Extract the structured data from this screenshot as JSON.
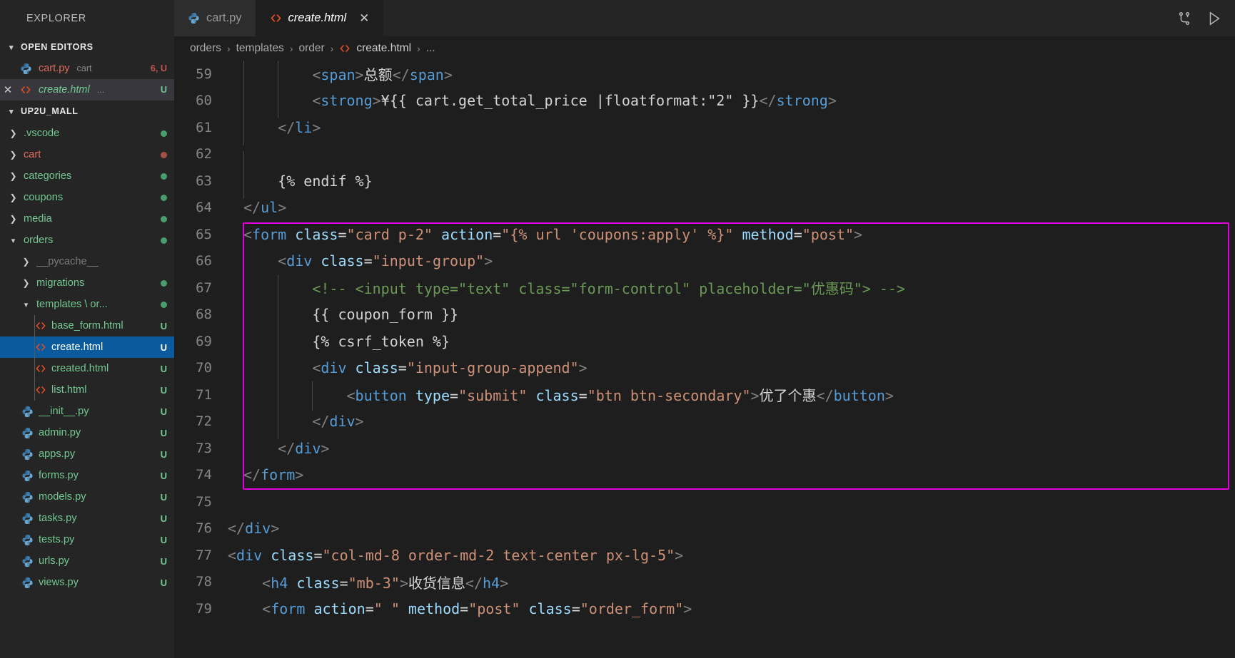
{
  "window": {
    "topbar_icons": [
      {
        "name": "source-control-icon",
        "glyph": "source-control"
      },
      {
        "name": "run-play-icon",
        "glyph": "play-outline"
      }
    ]
  },
  "sidebar": {
    "title": "EXPLORER",
    "open_editors": {
      "label": "OPEN EDITORS",
      "items": [
        {
          "name": "cart.py",
          "icon": "python-icon",
          "sub": "cart",
          "badge": "6, U",
          "badge_color": "#c0544d",
          "name_color": "#e06c5e",
          "selected": false,
          "closable": false,
          "italic": false
        },
        {
          "name": "create.html",
          "icon": "html-icon",
          "sub": "...",
          "badge": "U",
          "badge_color": "#73c991",
          "name_color": "#73c991",
          "selected": true,
          "closable": true,
          "italic": true
        }
      ]
    },
    "workspace": {
      "label": "UP2U_MALL",
      "items": [
        {
          "label": ".vscode",
          "type": "folder",
          "depth": 1,
          "expanded": false,
          "color": "#73c991",
          "dot": "#4a9e6d",
          "badge": ""
        },
        {
          "label": "cart",
          "type": "folder",
          "depth": 1,
          "expanded": false,
          "color": "#e06c5e",
          "dot": "#a35049",
          "badge": ""
        },
        {
          "label": "categories",
          "type": "folder",
          "depth": 1,
          "expanded": false,
          "color": "#73c991",
          "dot": "#4a9e6d",
          "badge": ""
        },
        {
          "label": "coupons",
          "type": "folder",
          "depth": 1,
          "expanded": false,
          "color": "#73c991",
          "dot": "#4a9e6d",
          "badge": ""
        },
        {
          "label": "media",
          "type": "folder",
          "depth": 1,
          "expanded": false,
          "color": "#73c991",
          "dot": "#4a9e6d",
          "badge": ""
        },
        {
          "label": "orders",
          "type": "folder",
          "depth": 1,
          "expanded": true,
          "color": "#73c991",
          "dot": "#4a9e6d",
          "badge": ""
        },
        {
          "label": "__pycache__",
          "type": "folder",
          "depth": 2,
          "expanded": false,
          "color": "#7a7a7a",
          "dot": "",
          "badge": ""
        },
        {
          "label": "migrations",
          "type": "folder",
          "depth": 2,
          "expanded": false,
          "color": "#73c991",
          "dot": "#4a9e6d",
          "badge": ""
        },
        {
          "label": "templates \\ or...",
          "type": "folder",
          "depth": 2,
          "expanded": true,
          "color": "#73c991",
          "dot": "#4a9e6d",
          "badge": ""
        },
        {
          "label": "base_form.html",
          "type": "html",
          "depth": 3,
          "expanded": false,
          "color": "#73c991",
          "dot": "",
          "badge": "U",
          "badge_color": "#73c991"
        },
        {
          "label": "create.html",
          "type": "html",
          "depth": 3,
          "expanded": false,
          "color": "#ffffff",
          "dot": "",
          "badge": "U",
          "badge_color": "#ffffff",
          "selected": true
        },
        {
          "label": "created.html",
          "type": "html",
          "depth": 3,
          "expanded": false,
          "color": "#73c991",
          "dot": "",
          "badge": "U",
          "badge_color": "#73c991"
        },
        {
          "label": "list.html",
          "type": "html",
          "depth": 3,
          "expanded": false,
          "color": "#73c991",
          "dot": "",
          "badge": "U",
          "badge_color": "#73c991"
        },
        {
          "label": "__init__.py",
          "type": "python",
          "depth": 2,
          "expanded": false,
          "color": "#73c991",
          "dot": "",
          "badge": "U",
          "badge_color": "#73c991"
        },
        {
          "label": "admin.py",
          "type": "python",
          "depth": 2,
          "expanded": false,
          "color": "#73c991",
          "dot": "",
          "badge": "U",
          "badge_color": "#73c991"
        },
        {
          "label": "apps.py",
          "type": "python",
          "depth": 2,
          "expanded": false,
          "color": "#73c991",
          "dot": "",
          "badge": "U",
          "badge_color": "#73c991"
        },
        {
          "label": "forms.py",
          "type": "python",
          "depth": 2,
          "expanded": false,
          "color": "#73c991",
          "dot": "",
          "badge": "U",
          "badge_color": "#73c991"
        },
        {
          "label": "models.py",
          "type": "python",
          "depth": 2,
          "expanded": false,
          "color": "#73c991",
          "dot": "",
          "badge": "U",
          "badge_color": "#73c991"
        },
        {
          "label": "tasks.py",
          "type": "python",
          "depth": 2,
          "expanded": false,
          "color": "#73c991",
          "dot": "",
          "badge": "U",
          "badge_color": "#73c991"
        },
        {
          "label": "tests.py",
          "type": "python",
          "depth": 2,
          "expanded": false,
          "color": "#73c991",
          "dot": "",
          "badge": "U",
          "badge_color": "#73c991"
        },
        {
          "label": "urls.py",
          "type": "python",
          "depth": 2,
          "expanded": false,
          "color": "#73c991",
          "dot": "",
          "badge": "U",
          "badge_color": "#73c991"
        },
        {
          "label": "views.py",
          "type": "python",
          "depth": 2,
          "expanded": false,
          "color": "#73c991",
          "dot": "",
          "badge": "U",
          "badge_color": "#73c991"
        }
      ]
    }
  },
  "tabs": [
    {
      "label": "cart.py",
      "icon": "python-icon",
      "active": false,
      "closable": false,
      "italic": false
    },
    {
      "label": "create.html",
      "icon": "html-icon",
      "active": true,
      "closable": true,
      "italic": true
    }
  ],
  "breadcrumb": {
    "parts": [
      "orders",
      "templates",
      "order"
    ],
    "file": "create.html",
    "ellipsis": "...",
    "separator": "›"
  },
  "editor": {
    "highlight_color": "#e000e0",
    "highlight_start_line": 65,
    "highlight_end_line": 74,
    "lines": [
      {
        "n": 59,
        "indent_guides": [
          0,
          1
        ],
        "tokens": [
          {
            "t": "txt",
            "v": "        "
          },
          {
            "t": "brk",
            "v": "<"
          },
          {
            "t": "tag",
            "v": "span"
          },
          {
            "t": "brk",
            "v": ">"
          },
          {
            "t": "txt",
            "v": "总额"
          },
          {
            "t": "brk",
            "v": "</"
          },
          {
            "t": "tag",
            "v": "span"
          },
          {
            "t": "brk",
            "v": ">"
          }
        ]
      },
      {
        "n": 60,
        "indent_guides": [
          0,
          1
        ],
        "tokens": [
          {
            "t": "txt",
            "v": "        "
          },
          {
            "t": "brk",
            "v": "<"
          },
          {
            "t": "tag",
            "v": "strong"
          },
          {
            "t": "brk",
            "v": ">"
          },
          {
            "t": "txt",
            "v": "¥{{ cart.get_total_price |floatformat:\"2\" }}"
          },
          {
            "t": "brk",
            "v": "</"
          },
          {
            "t": "tag",
            "v": "strong"
          },
          {
            "t": "brk",
            "v": ">"
          }
        ]
      },
      {
        "n": 61,
        "indent_guides": [
          0
        ],
        "tokens": [
          {
            "t": "txt",
            "v": "    "
          },
          {
            "t": "brk",
            "v": "</"
          },
          {
            "t": "tag",
            "v": "li"
          },
          {
            "t": "brk",
            "v": ">"
          }
        ]
      },
      {
        "n": 62,
        "indent_guides": [
          0
        ],
        "tokens": []
      },
      {
        "n": 63,
        "indent_guides": [
          0
        ],
        "tokens": [
          {
            "t": "txt",
            "v": "    "
          },
          {
            "t": "txt",
            "v": "{% endif %}"
          }
        ]
      },
      {
        "n": 64,
        "indent_guides": [],
        "tokens": [
          {
            "t": "brk",
            "v": "</"
          },
          {
            "t": "tag",
            "v": "ul"
          },
          {
            "t": "brk",
            "v": ">"
          }
        ]
      },
      {
        "n": 65,
        "indent_guides": [],
        "tokens": [
          {
            "t": "brk",
            "v": "<"
          },
          {
            "t": "tag",
            "v": "form"
          },
          {
            "t": "txt",
            "v": " "
          },
          {
            "t": "attr",
            "v": "class"
          },
          {
            "t": "eq",
            "v": "="
          },
          {
            "t": "str",
            "v": "\"card p-2\""
          },
          {
            "t": "txt",
            "v": " "
          },
          {
            "t": "attr",
            "v": "action"
          },
          {
            "t": "eq",
            "v": "="
          },
          {
            "t": "str",
            "v": "\"{% url 'coupons:apply' %}\""
          },
          {
            "t": "txt",
            "v": " "
          },
          {
            "t": "attr",
            "v": "method"
          },
          {
            "t": "eq",
            "v": "="
          },
          {
            "t": "str",
            "v": "\"post\""
          },
          {
            "t": "brk",
            "v": ">"
          }
        ]
      },
      {
        "n": 66,
        "indent_guides": [
          0
        ],
        "tokens": [
          {
            "t": "txt",
            "v": "    "
          },
          {
            "t": "brk",
            "v": "<"
          },
          {
            "t": "tag",
            "v": "div"
          },
          {
            "t": "txt",
            "v": " "
          },
          {
            "t": "attr",
            "v": "class"
          },
          {
            "t": "eq",
            "v": "="
          },
          {
            "t": "str",
            "v": "\"input-group\""
          },
          {
            "t": "brk",
            "v": ">"
          }
        ]
      },
      {
        "n": 67,
        "indent_guides": [
          0,
          1
        ],
        "tokens": [
          {
            "t": "txt",
            "v": "        "
          },
          {
            "t": "cmt",
            "v": "<!-- <input type=\"text\" class=\"form-control\" placeholder=\"优惠码\"> -->"
          }
        ]
      },
      {
        "n": 68,
        "indent_guides": [
          0,
          1
        ],
        "tokens": [
          {
            "t": "txt",
            "v": "        "
          },
          {
            "t": "txt",
            "v": "{{ coupon_form }}"
          }
        ]
      },
      {
        "n": 69,
        "indent_guides": [
          0,
          1
        ],
        "tokens": [
          {
            "t": "txt",
            "v": "        "
          },
          {
            "t": "txt",
            "v": "{% csrf_token %}"
          }
        ]
      },
      {
        "n": 70,
        "indent_guides": [
          0,
          1
        ],
        "tokens": [
          {
            "t": "txt",
            "v": "        "
          },
          {
            "t": "brk",
            "v": "<"
          },
          {
            "t": "tag",
            "v": "div"
          },
          {
            "t": "txt",
            "v": " "
          },
          {
            "t": "attr",
            "v": "class"
          },
          {
            "t": "eq",
            "v": "="
          },
          {
            "t": "str",
            "v": "\"input-group-append\""
          },
          {
            "t": "brk",
            "v": ">"
          }
        ]
      },
      {
        "n": 71,
        "indent_guides": [
          0,
          1,
          2
        ],
        "tokens": [
          {
            "t": "txt",
            "v": "            "
          },
          {
            "t": "brk",
            "v": "<"
          },
          {
            "t": "tag",
            "v": "button"
          },
          {
            "t": "txt",
            "v": " "
          },
          {
            "t": "attr",
            "v": "type"
          },
          {
            "t": "eq",
            "v": "="
          },
          {
            "t": "str",
            "v": "\"submit\""
          },
          {
            "t": "txt",
            "v": " "
          },
          {
            "t": "attr",
            "v": "class"
          },
          {
            "t": "eq",
            "v": "="
          },
          {
            "t": "str",
            "v": "\"btn btn-secondary\""
          },
          {
            "t": "brk",
            "v": ">"
          },
          {
            "t": "txt",
            "v": "优了个惠"
          },
          {
            "t": "brk",
            "v": "</"
          },
          {
            "t": "tag",
            "v": "button"
          },
          {
            "t": "brk",
            "v": ">"
          }
        ]
      },
      {
        "n": 72,
        "indent_guides": [
          0,
          1
        ],
        "tokens": [
          {
            "t": "txt",
            "v": "        "
          },
          {
            "t": "brk",
            "v": "</"
          },
          {
            "t": "tag",
            "v": "div"
          },
          {
            "t": "brk",
            "v": ">"
          }
        ]
      },
      {
        "n": 73,
        "indent_guides": [
          0
        ],
        "tokens": [
          {
            "t": "txt",
            "v": "    "
          },
          {
            "t": "brk",
            "v": "</"
          },
          {
            "t": "tag",
            "v": "div"
          },
          {
            "t": "brk",
            "v": ">"
          }
        ]
      },
      {
        "n": 74,
        "indent_guides": [],
        "tokens": [
          {
            "t": "brk",
            "v": "</"
          },
          {
            "t": "tag",
            "v": "form"
          },
          {
            "t": "brk",
            "v": ">"
          }
        ]
      },
      {
        "n": 75,
        "indent_guides": [],
        "tokens": []
      },
      {
        "n": 76,
        "indent_guides": [],
        "clip": 22,
        "tokens": [
          {
            "t": "brk",
            "v": "</"
          },
          {
            "t": "tag",
            "v": "div"
          },
          {
            "t": "brk",
            "v": ">"
          }
        ]
      },
      {
        "n": 77,
        "indent_guides": [],
        "clip": 22,
        "tokens": [
          {
            "t": "brk",
            "v": "<"
          },
          {
            "t": "tag",
            "v": "div"
          },
          {
            "t": "txt",
            "v": " "
          },
          {
            "t": "attr",
            "v": "class"
          },
          {
            "t": "eq",
            "v": "="
          },
          {
            "t": "str",
            "v": "\"col-md-8 order-md-2 text-center px-lg-5\""
          },
          {
            "t": "brk",
            "v": ">"
          }
        ]
      },
      {
        "n": 78,
        "indent_guides": [],
        "clip": 22,
        "tokens": [
          {
            "t": "txt",
            "v": "    "
          },
          {
            "t": "brk",
            "v": "<"
          },
          {
            "t": "tag",
            "v": "h4"
          },
          {
            "t": "txt",
            "v": " "
          },
          {
            "t": "attr",
            "v": "class"
          },
          {
            "t": "eq",
            "v": "="
          },
          {
            "t": "str",
            "v": "\"mb-3\""
          },
          {
            "t": "brk",
            "v": ">"
          },
          {
            "t": "txt",
            "v": "收货信息"
          },
          {
            "t": "brk",
            "v": "</"
          },
          {
            "t": "tag",
            "v": "h4"
          },
          {
            "t": "brk",
            "v": ">"
          }
        ]
      },
      {
        "n": 79,
        "indent_guides": [],
        "clip": 22,
        "tokens": [
          {
            "t": "txt",
            "v": "    "
          },
          {
            "t": "brk",
            "v": "<"
          },
          {
            "t": "tag",
            "v": "form"
          },
          {
            "t": "txt",
            "v": " "
          },
          {
            "t": "attr",
            "v": "action"
          },
          {
            "t": "eq",
            "v": "="
          },
          {
            "t": "str",
            "v": "\" \""
          },
          {
            "t": "txt",
            "v": " "
          },
          {
            "t": "attr",
            "v": "method"
          },
          {
            "t": "eq",
            "v": "="
          },
          {
            "t": "str",
            "v": "\"post\""
          },
          {
            "t": "txt",
            "v": " "
          },
          {
            "t": "attr",
            "v": "class"
          },
          {
            "t": "eq",
            "v": "="
          },
          {
            "t": "str",
            "v": "\"order_form\""
          },
          {
            "t": "brk",
            "v": ">"
          }
        ]
      }
    ]
  },
  "colors": {
    "editor_bg": "#1e1e1e",
    "sidebar_bg": "#252526",
    "selection_blue": "#0a5a9e",
    "accent_magenta": "#e000e0",
    "green_text": "#73c991",
    "red_text": "#e06c5e"
  }
}
